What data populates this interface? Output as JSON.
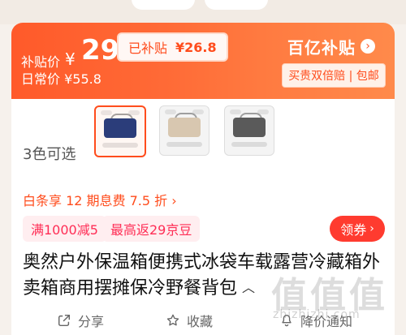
{
  "top_tabs": [
    {
      "label": ""
    },
    {
      "label": ""
    }
  ],
  "price_banner": {
    "subsidy_price_label": "补贴价",
    "currency": "¥",
    "subsidy_price": "29",
    "daily_price_label": "日常价",
    "daily_price": "¥55.8",
    "subsidized_label": "已补贴",
    "subsidized_amount": "¥26.8",
    "program_name": "百亿补贴",
    "program_badge": "买贵双倍赔 | 包邮"
  },
  "options": {
    "colors_label": "3色可选",
    "swatches": [
      {
        "color": "#2b3d7a"
      },
      {
        "color": "#d8c7b0"
      },
      {
        "color": "#5a5a5a"
      }
    ]
  },
  "installments": {
    "text": "白条享 12 期息费 7.5 折 ›"
  },
  "coupons": [
    {
      "text": "满1000减5"
    },
    {
      "text": "最高返29京豆"
    }
  ],
  "collect_coupon": {
    "label": "领券",
    "chevron": "›"
  },
  "product": {
    "title": "奥然户外保温箱便携式冰袋车载露营冷藏箱外卖箱商用摆摊保冷野餐背包",
    "title_caret": "︿"
  },
  "actions": [
    {
      "label": "分享",
      "icon": "share-icon"
    },
    {
      "label": "收藏",
      "icon": "star-icon"
    },
    {
      "label": "降价通知",
      "icon": "bell-icon"
    }
  ],
  "watermark": {
    "main": "值值值",
    "sub": "zhizhizhi.com"
  }
}
